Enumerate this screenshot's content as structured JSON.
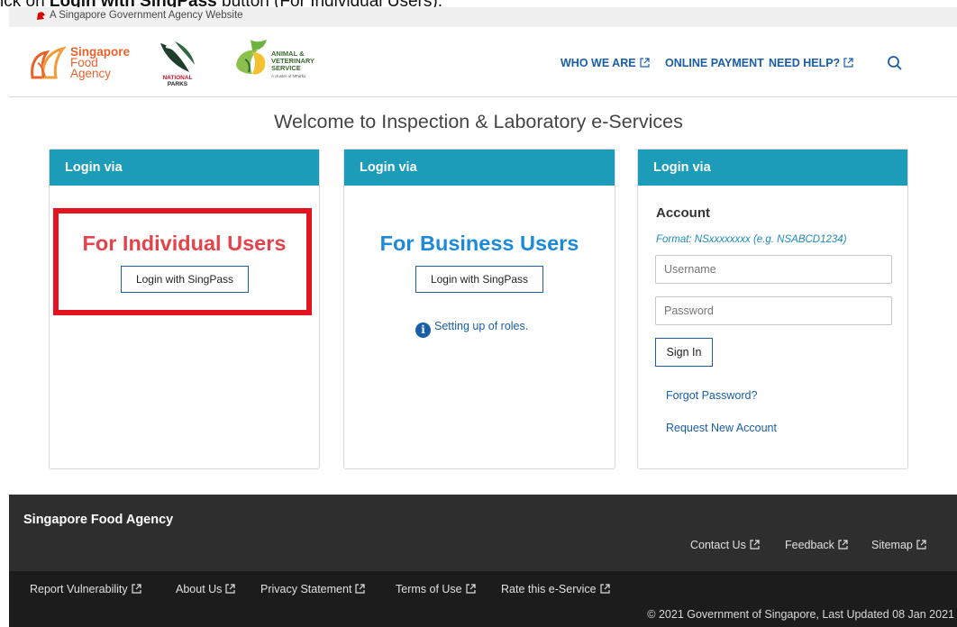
{
  "caption": {
    "prefix": "ick on ",
    "bold": "Login with SingPass",
    "suffix": " button (For Individual Users)."
  },
  "masthead": {
    "text": "A Singapore Government Agency Website"
  },
  "header": {
    "logos": {
      "sfa": [
        "Singapore",
        "Food",
        "Agency"
      ],
      "nparks": [
        "NATIONAL",
        "PARKS"
      ],
      "avs": [
        "ANIMAL &",
        "VETERINARY",
        "SERVICE"
      ],
      "avs_sub": "A cluster of NParks"
    },
    "nav": {
      "who_we_are": "WHO WE ARE",
      "online_payment": "ONLINE PAYMENT",
      "need_help": "NEED HELP?"
    }
  },
  "page_title": "Welcome to Inspection & Laboratory e-Services",
  "cards": {
    "individual": {
      "header": "Login via",
      "title": "For Individual Users",
      "button": "Login with SingPass"
    },
    "business": {
      "header": "Login via",
      "title": "For Business Users",
      "button": "Login with SingPass",
      "roles_link": "Setting up of roles."
    },
    "account": {
      "header": "Login via",
      "title": "Account",
      "format": "Format: NSxxxxxxxx (e.g. NSABCD1234)",
      "username_placeholder": "Username",
      "password_placeholder": "Password",
      "signin": "Sign In",
      "forgot": "Forgot Password?",
      "request": "Request New Account"
    }
  },
  "footer": {
    "title": "Singapore Food Agency",
    "links_right": [
      "Contact Us",
      "Feedback",
      "Sitemap"
    ],
    "links_left": [
      "Report Vulnerability",
      "About Us",
      "Privacy Statement",
      "Terms of Use",
      "Rate this e-Service"
    ],
    "copyright": "© 2021 Government of Singapore, Last Updated 08 Jan 2021"
  },
  "colors": {
    "accent_teal": "#1c9cb8",
    "link_blue": "#1a5ea8",
    "individual_red": "#e3434b",
    "business_blue": "#1c8ad8",
    "highlight_red": "#e3141f",
    "footer_dark": "#2e2e2e"
  }
}
